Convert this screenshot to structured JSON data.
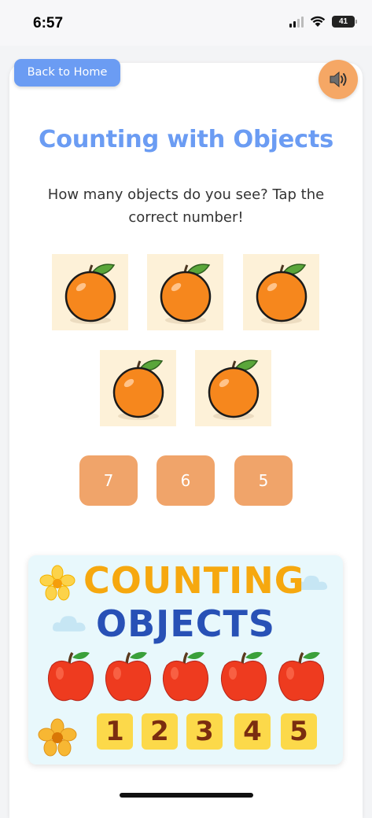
{
  "status_bar": {
    "time": "6:57",
    "battery": "41"
  },
  "header": {
    "back_label": "Back to Home",
    "sound_icon": "speaker-icon"
  },
  "title": "Counting with Objects",
  "question": "How many objects do you see? Tap the correct number!",
  "objects": {
    "icon": "orange-icon",
    "count": 5
  },
  "answers": [
    "7",
    "6",
    "5"
  ],
  "banner": {
    "line1": "COUNTING",
    "line2": "OBJECTS",
    "apple_count": 5,
    "numbers": [
      "1",
      "2",
      "3",
      "4",
      "5"
    ]
  },
  "colors": {
    "accent": "#6b9cf3",
    "answer_button": "#f0a46a",
    "sound_button": "#f5a765",
    "object_tile": "#fdf1d8"
  }
}
